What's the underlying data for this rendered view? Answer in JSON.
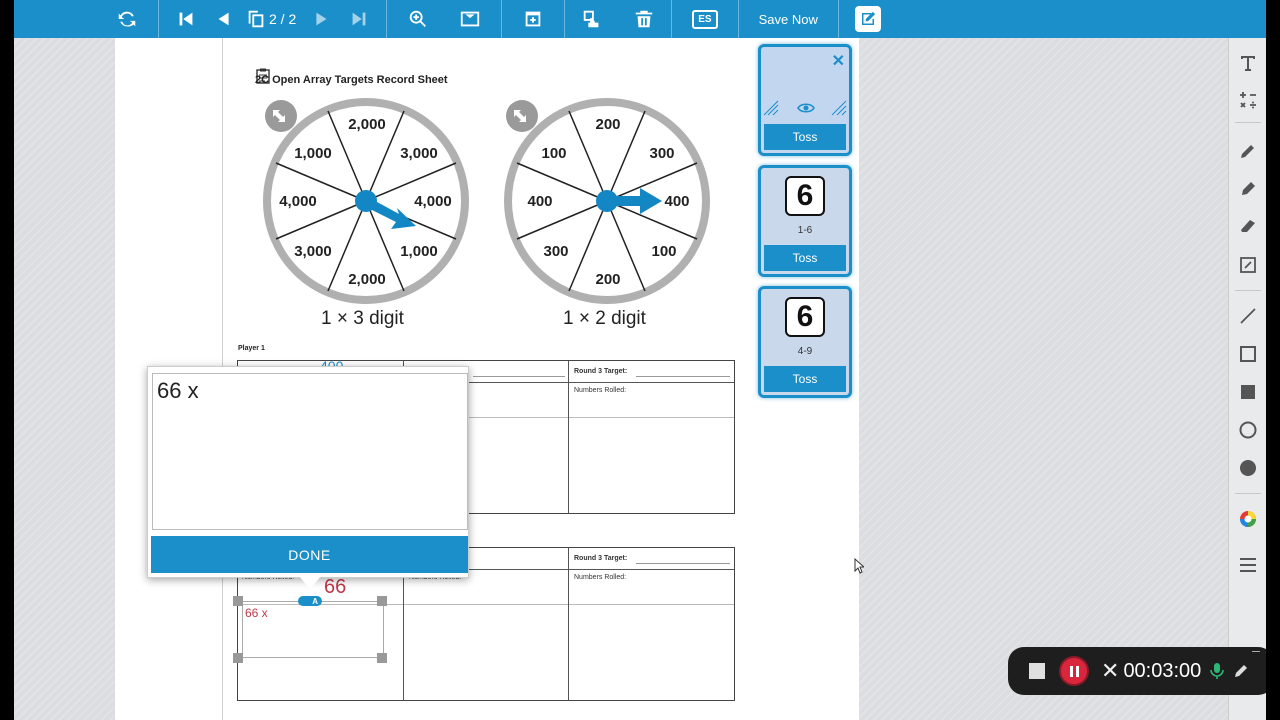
{
  "toolbar": {
    "page_indicator": "2 / 2",
    "language_label": "ES",
    "save_label": "Save Now"
  },
  "document": {
    "title": "2C Open Array Targets Record Sheet",
    "spinner1": {
      "label": "1 × 3 digit",
      "values": [
        "2,000",
        "3,000",
        "4,000",
        "1,000",
        "2,000",
        "3,000",
        "4,000",
        "1,000"
      ]
    },
    "spinner2": {
      "label": "1 × 2 digit",
      "values": [
        "200",
        "300",
        "400",
        "100",
        "200",
        "300",
        "400",
        "100"
      ]
    },
    "player_label": "Player 1",
    "round3_target": "Round 3 Target:",
    "numbers_rolled": "Numbers Rolled:",
    "partial_value": "400"
  },
  "popup": {
    "text": "66 x",
    "done_label": "DONE"
  },
  "annotation": {
    "big_number": "66",
    "small_text": "66 x",
    "badge": "A"
  },
  "side_panel": {
    "cards": [
      {
        "toss_label": "Toss"
      },
      {
        "die_value": "6",
        "range": "1-6",
        "toss_label": "Toss"
      },
      {
        "die_value": "6",
        "range": "4-9",
        "toss_label": "Toss"
      }
    ]
  },
  "recorder": {
    "time": "00:03:00"
  },
  "colors": {
    "accent": "#1b8fc9",
    "annotation_red": "#c0394b",
    "recorder_stop": "#d9263c"
  }
}
